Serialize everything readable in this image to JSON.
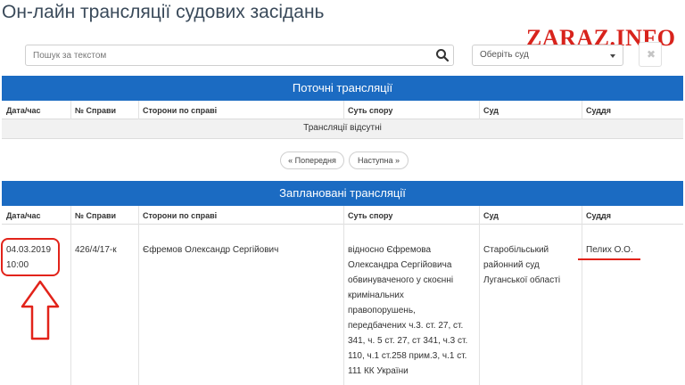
{
  "page": {
    "title": "Он-лайн трансляції судових засідань"
  },
  "watermark": {
    "text": "ZARAZ.INFO"
  },
  "search": {
    "placeholder": "Пошук за текстом"
  },
  "court_select": {
    "selected": "Оберіть суд"
  },
  "clear_button": {
    "label": "✖"
  },
  "columns": {
    "date": "Дата/час",
    "case": "№ Справи",
    "parties": "Сторони по справі",
    "subject": "Суть спору",
    "court": "Суд",
    "judge": "Суддя"
  },
  "current": {
    "title": "Поточні трансляції",
    "empty": "Трансляції відсутні"
  },
  "pagination": {
    "prev": "« Попередня",
    "next": "Наступна »"
  },
  "planned": {
    "title": "Заплановані трансляції",
    "rows": [
      {
        "date_line1": "04.03.2019",
        "date_line2": "10:00",
        "case": "426/4/17-к",
        "parties": "Єфремов Олександр Сергійович",
        "subject_lines": [
          "відносно Єфремова",
          "Олександра Сергійовича",
          "обвинуваченого у скоєнні",
          "кримінальних",
          "правопорушень,",
          "передбачених ч.3. ст. 27, ст.",
          "341, ч. 5 ст. 27, ст 341, ч.3 ст.",
          "110, ч.1 ст.258 прим.3, ч.1 ст.",
          "111 КК України"
        ],
        "court_lines": [
          "Старобільський",
          "районний суд",
          "Луганської області"
        ],
        "judge": "Пелих О.О."
      }
    ]
  },
  "colors": {
    "accent": "#1b6bc2",
    "annotation": "#e2231a",
    "watermark": "#d8231c"
  },
  "icons": {
    "search": "search-icon",
    "caret": "chevron-down-icon",
    "clear": "close-icon",
    "annotation_arrow": "arrow-up-icon"
  }
}
